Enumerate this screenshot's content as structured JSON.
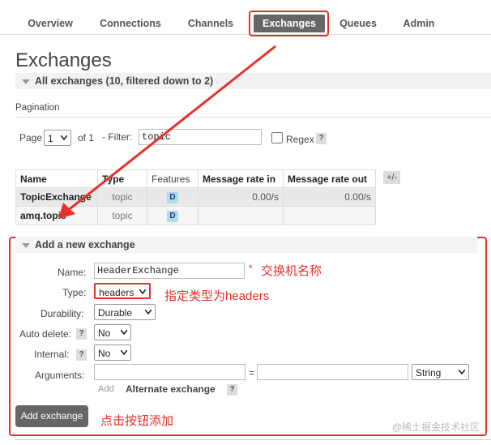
{
  "nav": {
    "tabs": [
      {
        "label": "Overview"
      },
      {
        "label": "Connections"
      },
      {
        "label": "Channels"
      },
      {
        "label": "Exchanges"
      },
      {
        "label": "Queues"
      },
      {
        "label": "Admin"
      }
    ],
    "active_tab": "Exchanges"
  },
  "page": {
    "title": "Exchanges",
    "all_exchanges_heading": "All exchanges (10, filtered down to 2)"
  },
  "pagination": {
    "heading": "Pagination",
    "page_label": "Page",
    "page_value": "1",
    "of_label": "of 1",
    "filter_label": "- Filter:",
    "filter_value": "topic",
    "regex_label": "Regex",
    "help": "?"
  },
  "table": {
    "headers": {
      "name": "Name",
      "type": "Type",
      "features": "Features",
      "rate_in": "Message rate in",
      "rate_out": "Message rate out"
    },
    "toggle": "+/-",
    "rows": [
      {
        "name": "TopicExchange",
        "type": "topic",
        "feature": "D",
        "rate_in": "0.00/s",
        "rate_out": "0.00/s"
      },
      {
        "name": "amq.topic",
        "type": "topic",
        "feature": "D",
        "rate_in": "",
        "rate_out": ""
      }
    ]
  },
  "add_form": {
    "heading": "Add a new exchange",
    "name_label": "Name:",
    "name_value": "HeaderExchange",
    "required_mark": "*",
    "type_label": "Type:",
    "type_value": "headers",
    "durability_label": "Durability:",
    "durability_value": "Durable",
    "auto_delete_label": "Auto delete:",
    "auto_delete_value": "No",
    "internal_label": "Internal:",
    "internal_value": "No",
    "arguments_label": "Arguments:",
    "arguments_key": "",
    "arguments_equals": "=",
    "arguments_value": "",
    "arguments_type": "String",
    "add_link": "Add",
    "alternate_exchange": "Alternate exchange",
    "help": "?",
    "submit_label": "Add exchange"
  },
  "annotations": {
    "name_note": "交换机名称",
    "type_note": "指定类型为headers",
    "button_note": "点击按钮添加",
    "color": "#e5312a"
  },
  "watermark": "@稀土掘金技术社区"
}
